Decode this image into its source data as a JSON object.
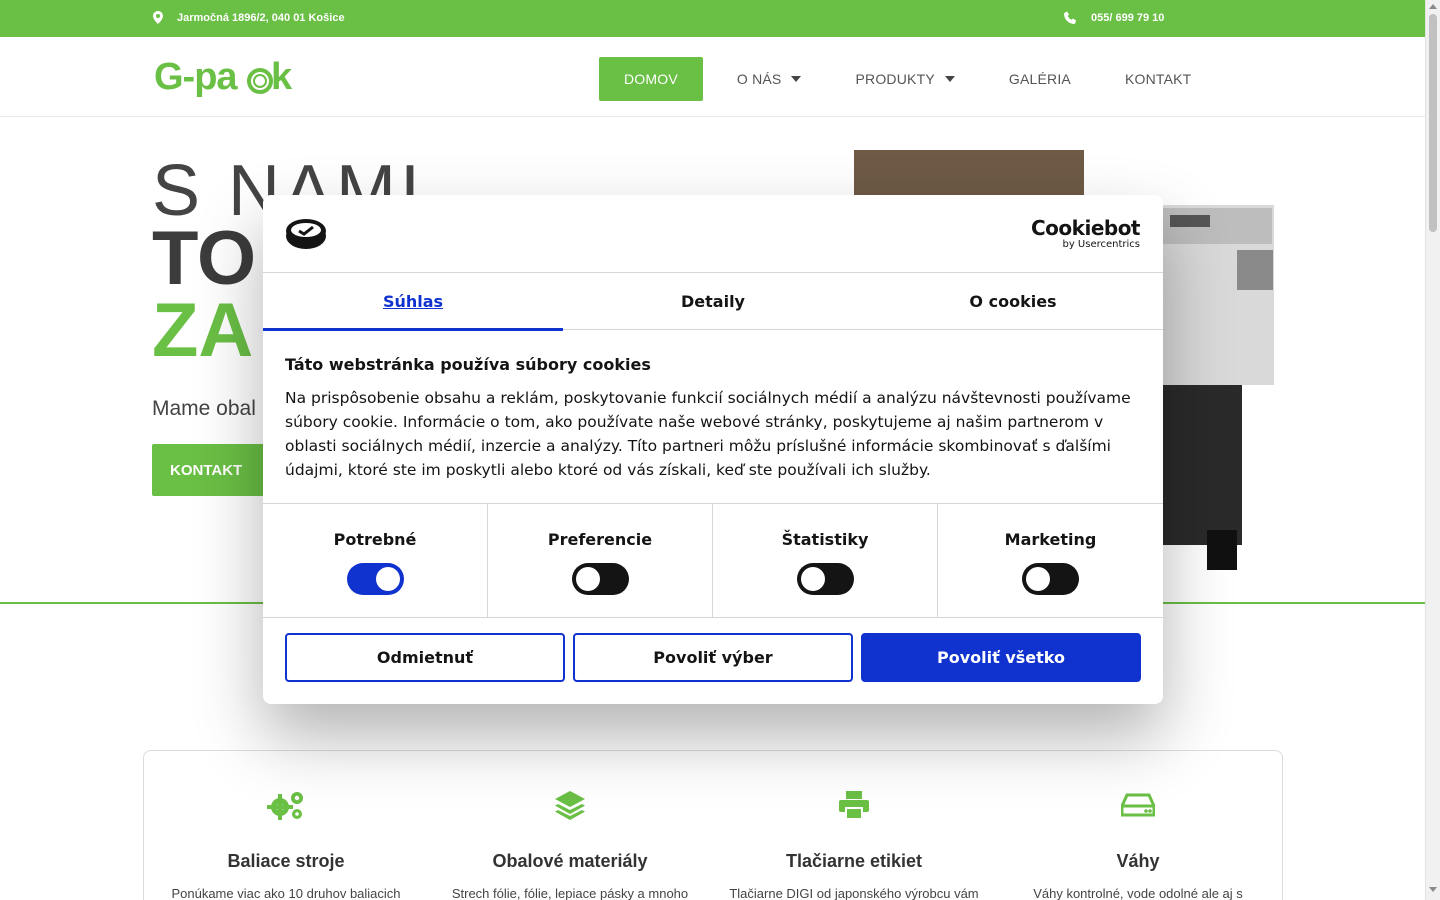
{
  "colors": {
    "brand_green": "#6abf45",
    "cookie_blue": "#1032cf",
    "text_dark": "#141414"
  },
  "topbar": {
    "address": "Jarmočná 1896/2, 040 01 Košice",
    "phone": "055/ 699 79 10"
  },
  "header": {
    "logo_text": "G-pack",
    "nav": [
      {
        "label": "DOMOV",
        "active": true
      },
      {
        "label": "O NÁS",
        "has_dropdown": true
      },
      {
        "label": "PRODUKTY",
        "has_dropdown": true
      },
      {
        "label": "GALÉRIA"
      },
      {
        "label": "KONTAKT"
      }
    ]
  },
  "hero": {
    "line1": "S NAMI",
    "line2": "TO",
    "line3": "ZA",
    "subtitle": "Mame obal n",
    "button": "KONTAKT"
  },
  "services": [
    {
      "icon": "gears-icon",
      "title": "Baliace stroje",
      "desc": "Ponúkame viac ako 10 druhov baliacich"
    },
    {
      "icon": "layers-icon",
      "title": "Obalové materiály",
      "desc": "Strech fólie, fólie, lepiace pásky a mnoho"
    },
    {
      "icon": "printer-icon",
      "title": "Tlačiarne etikiet",
      "desc": "Tlačiarne DIGI od japonského výrobcu vám"
    },
    {
      "icon": "scale-icon",
      "title": "Váhy",
      "desc": "Váhy kontrolné, vode odolné ale aj s"
    }
  ],
  "cookie_dialog": {
    "brand": "Cookiebot",
    "brand_sub": "by Usercentrics",
    "tabs": [
      {
        "label": "Súhlas",
        "active": true
      },
      {
        "label": "Detaily"
      },
      {
        "label": "O cookies"
      }
    ],
    "title": "Táto webstránka používa súbory cookies",
    "text": "Na prispôsobenie obsahu a reklám, poskytovanie funkcií sociálnych médií a analýzu návštevnosti používame súbory cookie. Informácie o tom, ako používate naše webové stránky, poskytujeme aj našim partnerom v oblasti sociálnych médií, inzercie a analýzy. Títo partneri môžu príslušné informácie skombinovať s ďalšími údajmi, ktoré ste im poskytli alebo ktoré od vás získali, keď ste používali ich služby.",
    "categories": [
      {
        "label": "Potrebné",
        "enabled": true
      },
      {
        "label": "Preferencie",
        "enabled": false
      },
      {
        "label": "Štatistiky",
        "enabled": false
      },
      {
        "label": "Marketing",
        "enabled": false
      }
    ],
    "buttons": {
      "decline": "Odmietnuť",
      "allow_selection": "Povoliť výber",
      "allow_all": "Povoliť všetko"
    }
  }
}
